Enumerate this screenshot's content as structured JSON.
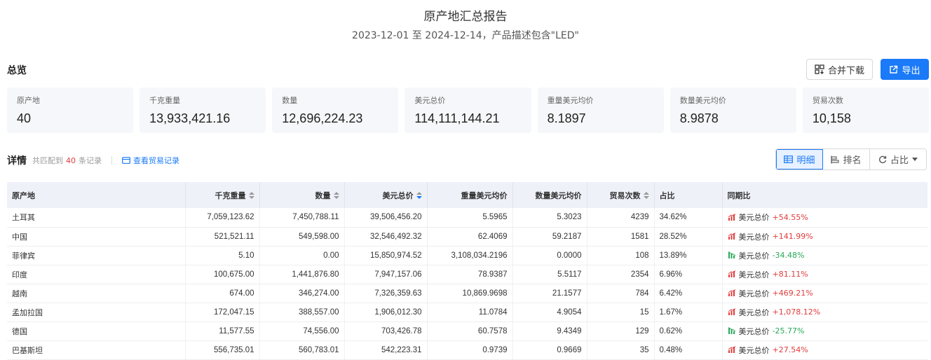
{
  "report": {
    "title": "原产地汇总报告",
    "subtitle": "2023-12-01 至 2024-12-14，产品描述包含\"LED\""
  },
  "overview": {
    "title": "总览",
    "merge_download_label": "合并下载",
    "export_label": "导出",
    "cards": [
      {
        "label": "原产地",
        "value": "40"
      },
      {
        "label": "千克重量",
        "value": "13,933,421.16"
      },
      {
        "label": "数量",
        "value": "12,696,224.23"
      },
      {
        "label": "美元总价",
        "value": "114,111,144.21"
      },
      {
        "label": "重量美元均价",
        "value": "8.1897"
      },
      {
        "label": "数量美元均价",
        "value": "8.9878"
      },
      {
        "label": "贸易次数",
        "value": "10,158"
      }
    ]
  },
  "detail": {
    "title": "详情",
    "match_prefix": "共匹配到",
    "match_count": "40",
    "match_suffix": "条记录",
    "view_trade_label": "查看贸易记录",
    "views": {
      "detail": "明细",
      "rank": "排名",
      "ratio": "占比"
    }
  },
  "table": {
    "headers": {
      "origin": "原产地",
      "weight": "千克重量",
      "quantity": "数量",
      "total_usd": "美元总价",
      "weight_avg": "重量美元均价",
      "qty_avg": "数量美元均价",
      "trades": "贸易次数",
      "share": "占比",
      "yoy": "同期比"
    },
    "yoy_metric": "美元总价",
    "rows": [
      {
        "origin": "土耳其",
        "weight": "7,059,123.62",
        "quantity": "7,450,788.11",
        "total_usd": "39,506,456.20",
        "weight_avg": "5.5965",
        "qty_avg": "5.3023",
        "trades": "4239",
        "share": "34.62%",
        "yoy": "+54.55%",
        "trend": "up"
      },
      {
        "origin": "中国",
        "weight": "521,521.11",
        "quantity": "549,598.00",
        "total_usd": "32,546,492.32",
        "weight_avg": "62.4069",
        "qty_avg": "59.2187",
        "trades": "1581",
        "share": "28.52%",
        "yoy": "+141.99%",
        "trend": "up"
      },
      {
        "origin": "菲律宾",
        "weight": "5.10",
        "quantity": "0.00",
        "total_usd": "15,850,974.52",
        "weight_avg": "3,108,034.2196",
        "qty_avg": "0.0000",
        "trades": "108",
        "share": "13.89%",
        "yoy": "-34.48%",
        "trend": "down"
      },
      {
        "origin": "印度",
        "weight": "100,675.00",
        "quantity": "1,441,876.80",
        "total_usd": "7,947,157.06",
        "weight_avg": "78.9387",
        "qty_avg": "5.5117",
        "trades": "2354",
        "share": "6.96%",
        "yoy": "+81.11%",
        "trend": "up"
      },
      {
        "origin": "越南",
        "weight": "674.00",
        "quantity": "346,274.00",
        "total_usd": "7,326,359.63",
        "weight_avg": "10,869.9698",
        "qty_avg": "21.1577",
        "trades": "784",
        "share": "6.42%",
        "yoy": "+469.21%",
        "trend": "up"
      },
      {
        "origin": "孟加拉国",
        "weight": "172,047.15",
        "quantity": "388,557.00",
        "total_usd": "1,906,012.30",
        "weight_avg": "11.0784",
        "qty_avg": "4.9054",
        "trades": "15",
        "share": "1.67%",
        "yoy": "+1,078.12%",
        "trend": "up"
      },
      {
        "origin": "德国",
        "weight": "11,577.55",
        "quantity": "74,556.00",
        "total_usd": "703,426.78",
        "weight_avg": "60.7578",
        "qty_avg": "9.4349",
        "trades": "129",
        "share": "0.62%",
        "yoy": "-25.77%",
        "trend": "down"
      },
      {
        "origin": "巴基斯坦",
        "weight": "556,735.01",
        "quantity": "560,783.01",
        "total_usd": "542,223.31",
        "weight_avg": "0.9739",
        "qty_avg": "0.9669",
        "trades": "35",
        "share": "0.48%",
        "yoy": "+27.54%",
        "trend": "up"
      }
    ]
  },
  "colors": {
    "accent": "#1a7af8",
    "up": "#e03c3c",
    "down": "#27a85a"
  },
  "icons": {
    "merge": "merge-download-icon",
    "export": "export-icon",
    "trade": "card-icon",
    "detail": "table-icon",
    "rank": "rank-icon",
    "ratio": "refresh-icon",
    "trend_up": "bar-chart-up-icon",
    "trend_down": "bar-chart-down-icon"
  }
}
